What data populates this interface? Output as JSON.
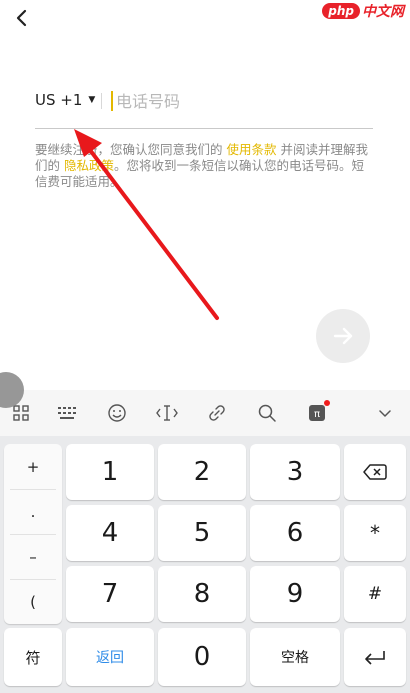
{
  "watermark": {
    "php": "php",
    "cn": "中文网"
  },
  "form": {
    "country_code": "US +1",
    "phone_placeholder": "电话号码",
    "terms": {
      "part1": "要继续注册，您确认您同意我们的 ",
      "terms_link": "使用条款",
      "part2": " 并阅读并理解我们的 ",
      "privacy_link": "隐私政策",
      "part3": "。您将收到一条短信以确认您的电话号码。短信费可能适用。"
    }
  },
  "keyboard": {
    "side_keys": [
      "+",
      ".",
      "–",
      "("
    ],
    "rows": [
      [
        "1",
        "2",
        "3"
      ],
      [
        "4",
        "5",
        "6"
      ],
      [
        "7",
        "8",
        "9"
      ]
    ],
    "right_keys": [
      "*",
      "#"
    ],
    "bottom": {
      "symbol": "符",
      "back": "返回",
      "zero": "0",
      "space": "空格"
    }
  },
  "colors": {
    "accent": "#e3b800",
    "link_blue": "#2f8ce8",
    "watermark_red": "#e8222a"
  }
}
